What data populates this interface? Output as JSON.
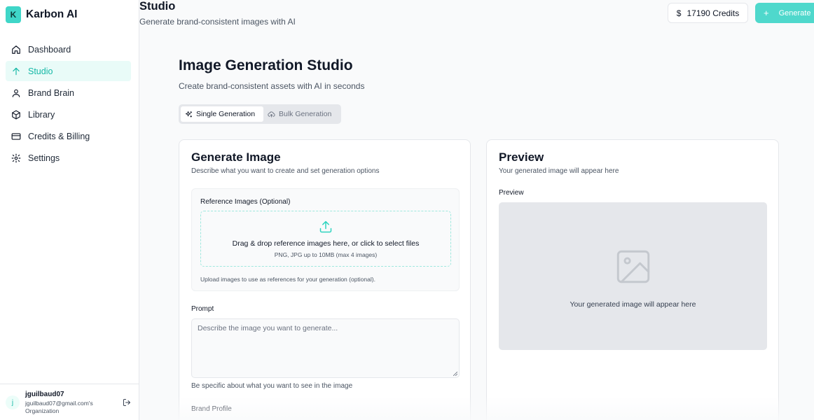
{
  "app": {
    "logo_letter": "K",
    "name": "Karbon AI"
  },
  "sidebar": {
    "items": [
      {
        "label": "Dashboard",
        "icon": "home-icon"
      },
      {
        "label": "Studio",
        "icon": "arrow-up-icon",
        "active": true
      },
      {
        "label": "Brand Brain",
        "icon": "user-icon"
      },
      {
        "label": "Library",
        "icon": "box-icon"
      },
      {
        "label": "Credits & Billing",
        "icon": "credit-card-icon"
      },
      {
        "label": "Settings",
        "icon": "gear-icon"
      }
    ]
  },
  "user": {
    "initial": "j",
    "name": "jguilbaud07",
    "org": "jguilbaud07@gmail.com's Organization"
  },
  "header": {
    "title": "Studio",
    "subtitle": "Generate brand-consistent images with AI",
    "credits_symbol": "$",
    "credits_label": "17190 Credits",
    "generate_label": "Generate"
  },
  "studio": {
    "title": "Image Generation Studio",
    "subtitle": "Create brand-consistent assets with AI in seconds",
    "tabs": [
      {
        "label": "Single Generation",
        "active": true
      },
      {
        "label": "Bulk Generation",
        "active": false
      }
    ]
  },
  "generate_card": {
    "title": "Generate Image",
    "subtitle": "Describe what you want to create and set generation options",
    "reference": {
      "label": "Reference Images (Optional)",
      "drop_text": "Drag & drop reference images here, or click to select files",
      "drop_hint": "PNG, JPG up to 10MB (max 4 images)",
      "help": "Upload images to use as references for your generation (optional)."
    },
    "prompt": {
      "label": "Prompt",
      "placeholder": "Describe the image you want to generate...",
      "value": "",
      "help": "Be specific about what you want to see in the image"
    },
    "brand_profile_label": "Brand Profile"
  },
  "preview_card": {
    "title": "Preview",
    "subtitle": "Your generated image will appear here",
    "label": "Preview",
    "empty_message": "Your generated image will appear here"
  },
  "colors": {
    "accent": "#14b8a6",
    "accent_button": "#4fd8cc",
    "active_bg": "#e9fbf8",
    "page_bg": "#f9fafb"
  }
}
